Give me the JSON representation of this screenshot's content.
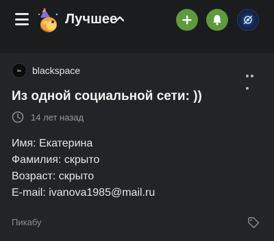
{
  "header": {
    "menu_icon": "hamburger-icon",
    "logo_icon": "pikabu-mascot-icon",
    "title": "Лучшее",
    "chevron_icon": "chevron-up-icon",
    "actions": {
      "add_icon": "plus-icon",
      "notifications_icon": "bell-icon",
      "profile_icon": "user-avatar"
    },
    "accent_color": "#5f9a3e"
  },
  "post": {
    "author": {
      "name": "blackspace",
      "avatar_icon": "author-avatar"
    },
    "more_icon": "more-dots-icon",
    "title": "Из одной социальной сети: ))",
    "time_icon": "clock-icon",
    "time": "14 лет назад",
    "content": [
      "Имя: Екатерина",
      "Фамилия: скрыто",
      "Возраст: скрыто",
      "E-mail: ivanova1985@mail.ru"
    ],
    "footer": {
      "tag": "Пикабу",
      "tag_icon": "tag-icon"
    }
  }
}
